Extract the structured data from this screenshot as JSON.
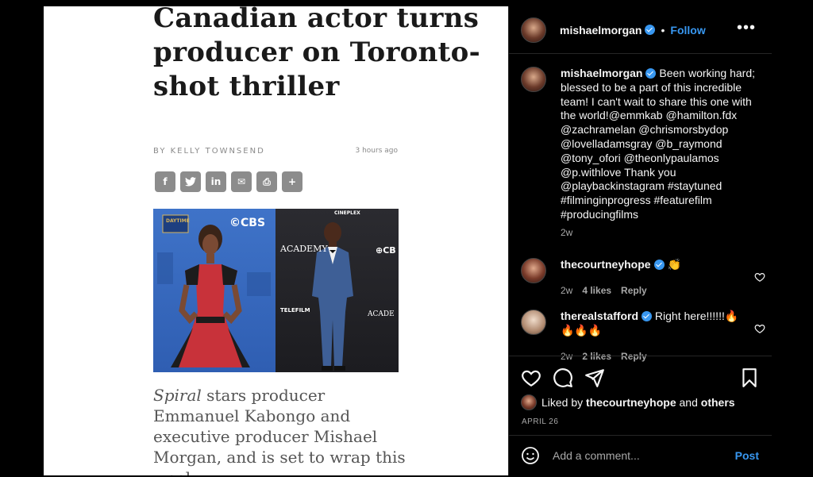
{
  "article": {
    "headline": "Canadian actor turns producer on Toronto-shot thriller",
    "byline_prefix": "BY",
    "author": "KELLY TOWNSEND",
    "timestamp": "3 hours ago",
    "share_buttons": [
      {
        "icon": "facebook-icon",
        "glyph": "f"
      },
      {
        "icon": "twitter-icon",
        "glyph": "🐦"
      },
      {
        "icon": "linkedin-icon",
        "glyph": "in"
      },
      {
        "icon": "email-icon",
        "glyph": "✉"
      },
      {
        "icon": "print-icon",
        "glyph": "⎙"
      },
      {
        "icon": "plus-icon",
        "glyph": "+"
      }
    ],
    "photo_logos": {
      "cbs": "©CBS",
      "daytime": "DAYTIME",
      "academy": "ACADEMY",
      "cineplex": "CINEPLEX",
      "telefilm": "TELEFILM",
      "cbc": "⊕CB",
      "acade": "ACADE"
    },
    "body_title": "Spiral",
    "body_text": " stars producer Emmanuel Kabongo and executive producer Mishael Morgan, and is set to wrap this week."
  },
  "post": {
    "username": "mishaelmorgan",
    "follow_label": "Follow",
    "more_label": "•••",
    "caption_user": "mishaelmorgan",
    "caption_text": "Been working hard; blessed to be a part of this incredible team! I can't wait to share this one with the world!@emmkab @hamilton.fdx @zachramelan @chrismorsbydop @lovelladamsgray @b_raymond @tony_ofori @theonlypaulamos @p.withlove Thank you @playbackinstagram #staytuned #filminginprogress #featurefilm #producingfilms",
    "caption_time": "2w",
    "comments": [
      {
        "user": "thecourtneyhope",
        "text": "👏",
        "time": "2w",
        "likes": "4 likes",
        "reply": "Reply"
      },
      {
        "user": "therealstafford",
        "text": "Right here!!!!!!🔥🔥🔥🔥",
        "time": "2w",
        "likes": "2 likes",
        "reply": "Reply"
      }
    ],
    "liked_by_prefix": "Liked by ",
    "liked_by_user": "thecourtneyhope",
    "liked_by_and": " and ",
    "liked_by_others": "others",
    "date": "APRIL 26",
    "comment_placeholder": "Add a comment...",
    "post_label": "Post",
    "accent_color": "#3897f0"
  }
}
